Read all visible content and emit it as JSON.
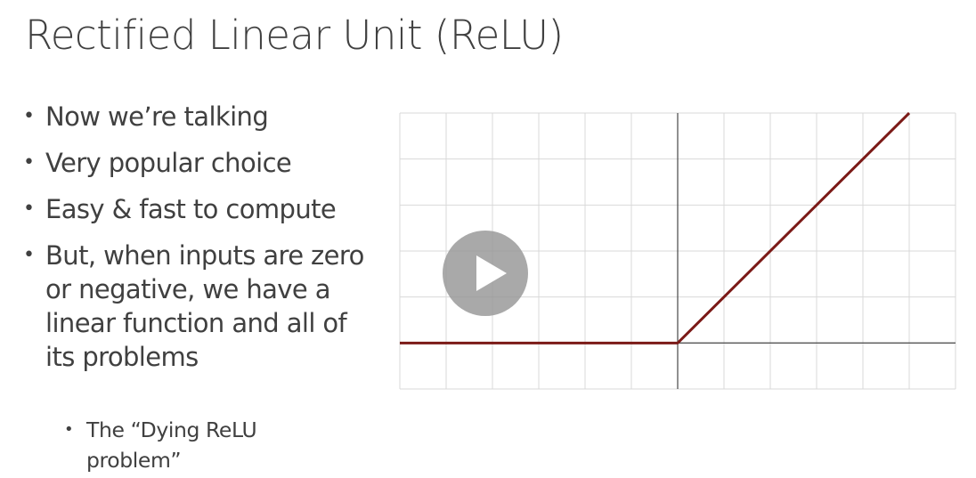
{
  "slide": {
    "title": "Rectified Linear Unit (ReLU)",
    "bullets": [
      {
        "text": "Now we’re talking"
      },
      {
        "text": "Very popular choice"
      },
      {
        "text": "Easy & fast to compute"
      },
      {
        "text": "But, when inputs are zero or negative, we have a linear function and all of its problems"
      }
    ],
    "sub_bullets": [
      {
        "text": "The “Dying ReLU problem”"
      }
    ]
  },
  "video": {
    "play_icon": "play-icon",
    "overlay_color": "#969696"
  },
  "chart_data": {
    "type": "line",
    "title": "",
    "xlabel": "",
    "ylabel": "",
    "function": "ReLU: y = max(0, x)",
    "xlim": [
      -6,
      6
    ],
    "ylim": [
      -1,
      5
    ],
    "grid": true,
    "x_gridlines": [
      -6,
      -5,
      -4,
      -3,
      -2,
      -1,
      0,
      1,
      2,
      3,
      4,
      5,
      6
    ],
    "y_gridlines": [
      -1,
      0,
      1,
      2,
      3,
      4,
      5
    ],
    "series": [
      {
        "x": [
          -6,
          0,
          5
        ],
        "y": [
          0,
          0,
          5
        ],
        "color": "#7b1a17"
      }
    ],
    "axis_color": "#555555",
    "grid_color": "#d9d9d9"
  }
}
